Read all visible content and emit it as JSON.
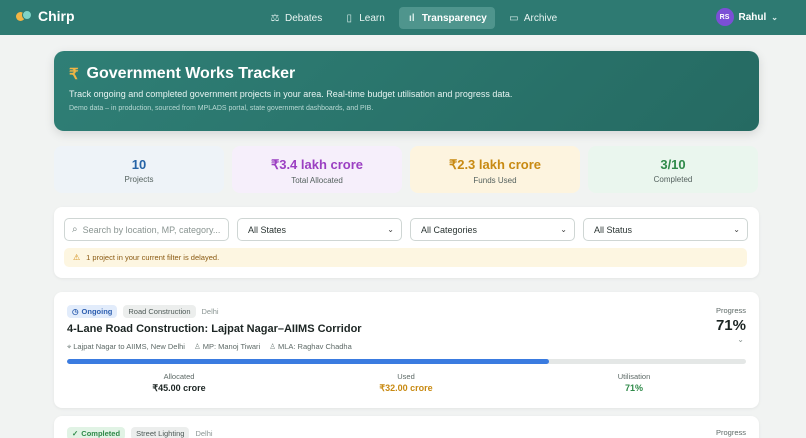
{
  "app": {
    "name": "Chirp"
  },
  "nav": {
    "items": [
      {
        "label": "Debates",
        "icon": "debates-icon",
        "active": false
      },
      {
        "label": "Learn",
        "icon": "book-icon",
        "active": false
      },
      {
        "label": "Transparency",
        "icon": "bar-chart-icon",
        "active": true
      },
      {
        "label": "Archive",
        "icon": "archive-icon",
        "active": false
      }
    ]
  },
  "user": {
    "initials": "RS",
    "name": "Rahul",
    "avatar_color": "#7b4fd6"
  },
  "hero": {
    "icon": "₹",
    "title": "Government Works Tracker",
    "subtitle": "Track ongoing and completed government projects in your area. Real-time budget utilisation and progress data.",
    "note": "Demo data – in production, sourced from MPLADS portal, state government dashboards, and PIB."
  },
  "stats": [
    {
      "value": "10",
      "label": "Projects"
    },
    {
      "value": "₹3.4 lakh crore",
      "label": "Total Allocated"
    },
    {
      "value": "₹2.3 lakh crore",
      "label": "Funds Used"
    },
    {
      "value": "3/10",
      "label": "Completed"
    }
  ],
  "filters": {
    "search_placeholder": "Search by location, MP, category...",
    "states": "All States",
    "categories": "All Categories",
    "status": "All Status",
    "alert": "1 project in your current filter is delayed."
  },
  "projects": [
    {
      "status": "Ongoing",
      "category": "Road Construction",
      "region": "Delhi",
      "title": "4-Lane Road Construction: Lajpat Nagar–AIIMS Corridor",
      "location": "Lajpat Nagar to AIIMS, New Delhi",
      "mp": "MP: Manoj Tiwari",
      "mla": "MLA: Raghav Chadha",
      "progress_label": "Progress",
      "progress_text": "71%",
      "progress": 0.71,
      "allocated_label": "Allocated",
      "allocated": "₹45.00 crore",
      "used_label": "Used",
      "used": "₹32.00 crore",
      "utilisation_label": "Utilisation",
      "utilisation": "71%"
    },
    {
      "status": "Completed",
      "category": "Street Lighting",
      "region": "Delhi",
      "progress_label": "Progress"
    }
  ],
  "colors": {
    "nav": "#2e7a72",
    "hero": "#2f7f76",
    "accent_gold": "#c88a12",
    "progress": "#3a7be0"
  }
}
